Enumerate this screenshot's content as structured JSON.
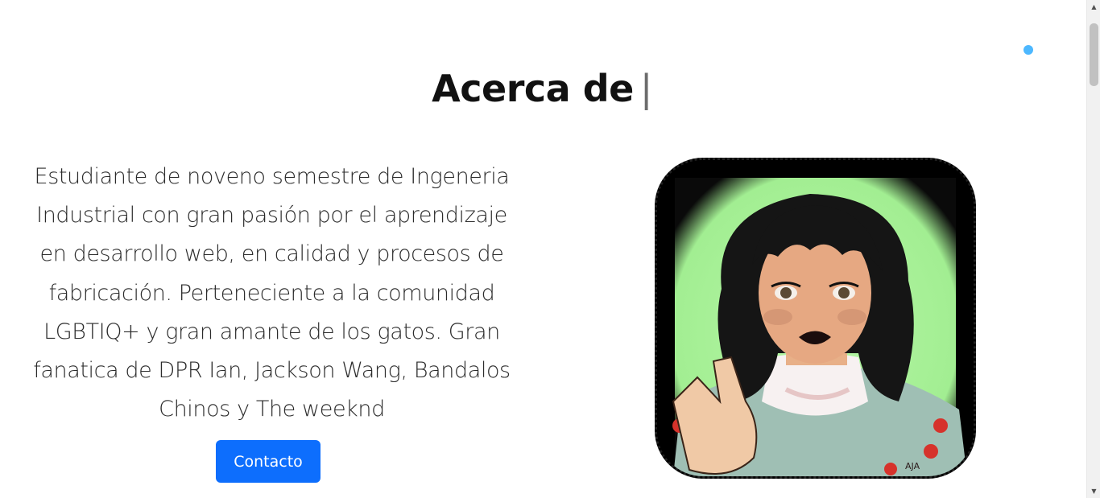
{
  "section": {
    "title": "Acerca de",
    "caret": "|",
    "bio": "Estudiante de noveno semestre de Ingeneria Industrial con gran pasión por el aprendizaje en desarrollo web, en calidad y procesos de fabricación. Perteneciente a la comunidad LGBTIQ+ y gran amante de los gatos. Gran fanatica de DPR Ian, Jackson Wang, Bandalos Chinos y The weeknd",
    "contact_label": "Contacto"
  },
  "avatar": {
    "signature": "AJA"
  },
  "icons": {
    "scroll_up": "▲",
    "scroll_down": "▼"
  },
  "colors": {
    "button": "#0d6efd",
    "cursor_dot": "#4db8ff",
    "avatar_background": "#a8f29a"
  }
}
